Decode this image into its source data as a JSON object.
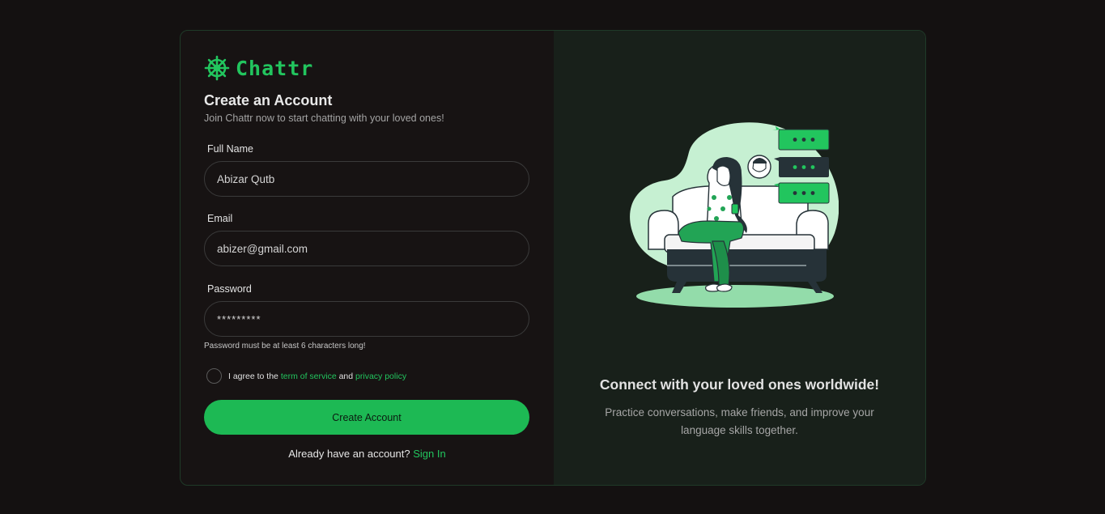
{
  "brand": {
    "name": "Chattr",
    "color": "#22c55e",
    "icon": "ship-wheel-icon"
  },
  "form": {
    "title": "Create an Account",
    "subtitle": "Join Chattr now to start chatting with your loved ones!",
    "full_name": {
      "label": "Full Name",
      "value": "Abizar Qutb"
    },
    "email": {
      "label": "Email",
      "value": "abizer@gmail.com"
    },
    "password": {
      "label": "Password",
      "value": "*********",
      "hint": "Password must be at least 6 characters long!"
    },
    "agree": {
      "prefix": "I agree to the",
      "terms_link": "term of service",
      "and": "and",
      "privacy_link": "privacy policy",
      "checked": false
    },
    "submit_label": "Create Account",
    "signin_prompt": "Already have an account?",
    "signin_link": "Sign In"
  },
  "promo": {
    "title": "Connect with your loved ones worldwide!",
    "subtitle": "Practice conversations, make friends, and improve your language skills together."
  }
}
